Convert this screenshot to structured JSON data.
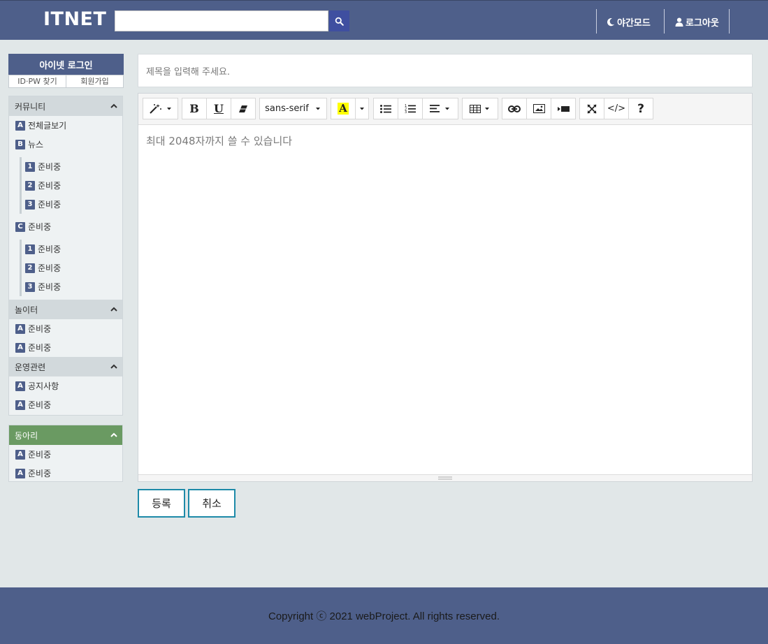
{
  "header": {
    "logo": "ITNET",
    "search": {
      "value": "",
      "placeholder": ""
    },
    "night_mode": "야간모드",
    "logout": "로그아웃"
  },
  "sidebar": {
    "login": {
      "title": "아이넷 로그인",
      "find": "ID·PW 찾기",
      "signup": "회원가입"
    },
    "community": {
      "title": "커뮤니티",
      "items": [
        {
          "badge": "A",
          "label": "전체글보기"
        },
        {
          "badge": "B",
          "label": "뉴스"
        }
      ],
      "sub_b": [
        {
          "badge": "1",
          "label": "준비중"
        },
        {
          "badge": "2",
          "label": "준비중"
        },
        {
          "badge": "3",
          "label": "준비중"
        }
      ],
      "item_c": {
        "badge": "C",
        "label": "준비중"
      },
      "sub_c": [
        {
          "badge": "1",
          "label": "준비중"
        },
        {
          "badge": "2",
          "label": "준비중"
        },
        {
          "badge": "3",
          "label": "준비중"
        }
      ]
    },
    "playground": {
      "title": "놀이터",
      "items": [
        {
          "badge": "A",
          "label": "준비중"
        },
        {
          "badge": "A",
          "label": "준비중"
        }
      ]
    },
    "operations": {
      "title": "운영관련",
      "items": [
        {
          "badge": "A",
          "label": "공지사항"
        },
        {
          "badge": "A",
          "label": "준비중"
        }
      ]
    },
    "club": {
      "title": "동아리",
      "items": [
        {
          "badge": "A",
          "label": "준비중"
        },
        {
          "badge": "A",
          "label": "준비중"
        }
      ]
    }
  },
  "main": {
    "title_placeholder": "제목을 입력해 주세요.",
    "editor": {
      "placeholder": "최대 2048자까지 쓸 수 있습니다",
      "font_name": "sans-serif",
      "bold": "B",
      "underline": "U",
      "color_letter": "A",
      "help": "?",
      "code": "</>"
    },
    "submit": "등록",
    "cancel": "취소"
  },
  "footer": {
    "copyright": "Copyright ⓒ 2021 webProject. All rights reserved."
  },
  "colors": {
    "header": "#4e5f8a",
    "accent": "#1d8aa8",
    "club": "#6a9a62",
    "bg": "#e1e7e8"
  }
}
